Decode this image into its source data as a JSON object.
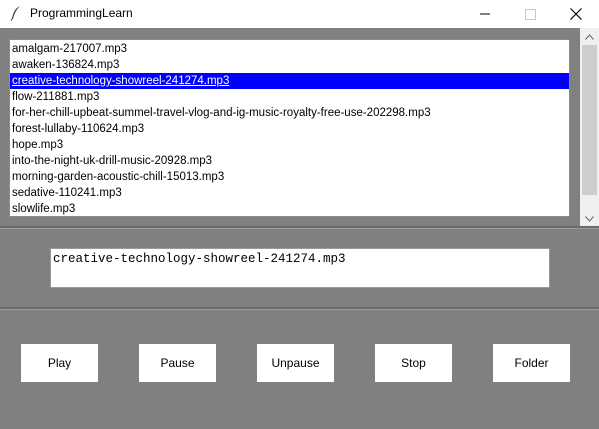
{
  "window": {
    "title": "ProgrammingLearn",
    "icon": "feather-icon"
  },
  "listbox": {
    "items": [
      "amalgam-217007.mp3",
      "awaken-136824.mp3",
      "creative-technology-showreel-241274.mp3",
      "flow-211881.mp3",
      "for-her-chill-upbeat-summel-travel-vlog-and-ig-music-royalty-free-use-202298.mp3",
      "forest-lullaby-110624.mp3",
      "hope.mp3",
      "into-the-night-uk-drill-music-20928.mp3",
      "morning-garden-acoustic-chill-15013.mp3",
      "sedative-110241.mp3",
      "slowlife.mp3"
    ],
    "selected_index": 2
  },
  "current_track": {
    "value": "creative-technology-showreel-241274.mp3"
  },
  "controls": {
    "play": "Play",
    "pause": "Pause",
    "unpause": "Unpause",
    "stop": "Stop",
    "folder": "Folder"
  },
  "colors": {
    "selection": "#0000ff",
    "background": "#808080"
  }
}
